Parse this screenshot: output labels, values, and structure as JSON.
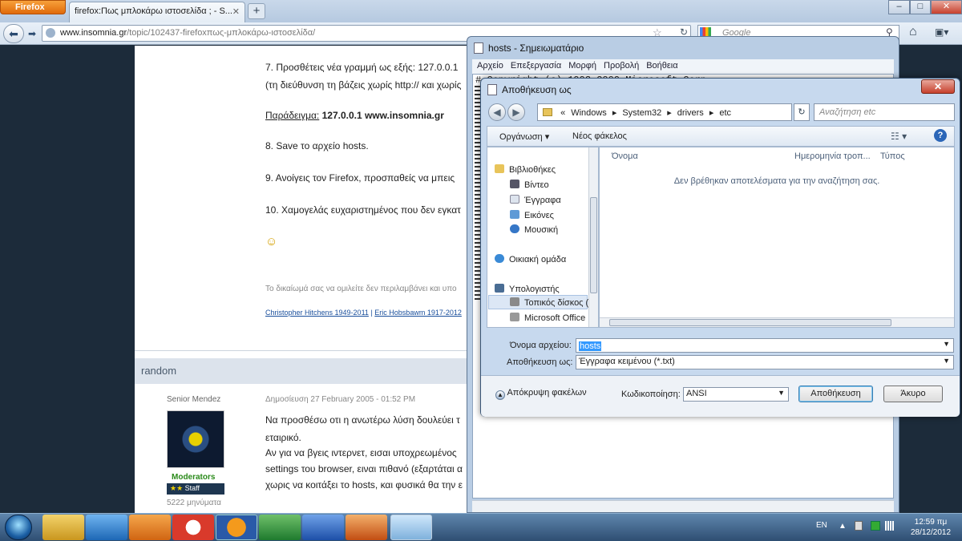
{
  "browser": {
    "app_button": "Firefox",
    "tab_title": "firefox:Πως μπλοκάρω ιστοσελίδα ; - S...",
    "url_domain": "www.insomnia.gr",
    "url_path": "/topic/102437-firefoxπως-μπλοκάρω-ιστοσελίδα/",
    "search_placeholder": "Google"
  },
  "page": {
    "step7": "7. Προσθέτεις νέα γραμμή ως εξής: 127.0.0.1",
    "step7_sub": "(τη διεύθυνση τη βάζεις χωρίς http:// και χωρίς",
    "example_label": "Παράδειγμα:",
    "example_value": "127.0.0.1 www.insomnia.gr",
    "step8": "8. Save το αρχείο hosts.",
    "step9": "9. Ανοίγεις τον Firefox, προσπαθείς να μπεις",
    "step10": "10. Χαμογελάς ευχαριστημένος που δεν εγκατ",
    "signature_note": "Το δικαίωμά σας να ομιλείτε δεν περιλαμβάνει και υπο",
    "sig_link1": "Christopher Hitchens 1949-2011",
    "sig_sep": "|",
    "sig_link2": "Eric Hobsbawm 1917-2012",
    "section_title": "random",
    "author_rank": "Senior Mendez",
    "post_date": "Δημοσίευση 27 February 2005 - 01:52 PM",
    "author_group": "Moderators",
    "author_badge": "Staff",
    "author_posts": "5222 μηνύματα",
    "post_lines": [
      "Να προσθέσω οτι η ανωτέρω λύση δουλεύει τ",
      "εταιρικό.",
      "Αν για να βγεις ιντερνετ, εισαι υποχρεωμένος",
      "settings του browser, ειναι πιθανό (εξαρτάται α",
      "χωρις να κοιτάξει το hosts, και φυσικά θα την ε"
    ]
  },
  "notepad": {
    "title": "hosts - Σημειωματάριο",
    "menu": [
      "Αρχείο",
      "Επεξεργασία",
      "Μορφή",
      "Προβολή",
      "Βοήθεια"
    ],
    "first_line": "# Copyright (c) 1993-2009 Microsoft Corp."
  },
  "dialog": {
    "title": "Αποθήκευση ως",
    "path": [
      "«",
      "Windows",
      "▸",
      "System32",
      "▸",
      "drivers",
      "▸",
      "etc"
    ],
    "search_placeholder": "Αναζήτηση etc",
    "organize": "Οργάνωση ▾",
    "new_folder": "Νέος φάκελος",
    "nav": {
      "libraries": "Βιβλιοθήκες",
      "video": "Βίντεο",
      "documents": "Έγγραφα",
      "pictures": "Εικόνες",
      "music": "Μουσική",
      "homegroup": "Οικιακή ομάδα",
      "computer": "Υπολογιστής",
      "local_disk": "Τοπικός δίσκος (",
      "office": "Microsoft Office"
    },
    "columns": [
      "Όνομα",
      "Ημερομηνία τροπ...",
      "Τύπος"
    ],
    "empty_message": "Δεν βρέθηκαν αποτελέσματα για την αναζήτηση σας.",
    "filename_label": "Όνομα αρχείου:",
    "filename_value": "hosts",
    "savetype_label": "Αποθήκευση ως:",
    "savetype_value": "Έγγραφα κειμένου (*.txt)",
    "hide_folders": "Απόκρυψη φακέλων",
    "encoding_label": "Κωδικοποίηση:",
    "encoding_value": "ANSI",
    "save_button": "Αποθήκευση",
    "cancel_button": "Άκυρο"
  },
  "taskbar": {
    "language": "EN",
    "time": "12:59 πμ",
    "date": "28/12/2012"
  },
  "colors": {
    "accent_orange": "#e06a0a",
    "link_blue": "#1a4f9c",
    "moderator_green": "#2a8a1a"
  }
}
